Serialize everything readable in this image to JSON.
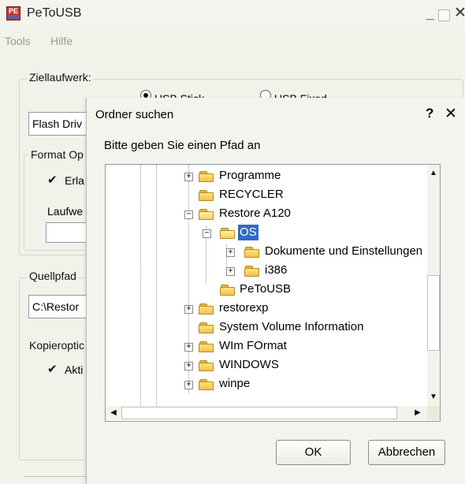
{
  "app": {
    "title": "PeToUSB",
    "icon_text": "PE",
    "menu": [
      "Tools",
      "Hilfe"
    ]
  },
  "main": {
    "ziellaufwerk_label": "Ziellaufwerk:",
    "radio_usb_stick": "USB Stick",
    "radio_usb_fixed": "USB Fixed",
    "drive_value": "Flash Driv",
    "format_label": "Format Op",
    "format_checkbox_label": "Erla",
    "laufwerk_label": "Laufwe",
    "quellpfad_label": "Quellpfad",
    "quellpfad_value": "C:\\Restor",
    "kopier_label": "Kopieroptic",
    "kopier_checkbox_label": "Akti"
  },
  "dialog": {
    "title": "Ordner suchen",
    "help": "?",
    "close": "✕",
    "prompt": "Bitte geben Sie einen Pfad an",
    "tree": [
      {
        "label": "Programme",
        "expander": "+",
        "level": 0
      },
      {
        "label": "RECYCLER",
        "expander": "",
        "level": 0
      },
      {
        "label": "Restore A120",
        "expander": "−",
        "level": 0
      },
      {
        "label": "OS",
        "expander": "−",
        "level": 1,
        "selected": true
      },
      {
        "label": "Dokumente und Einstellungen",
        "expander": "+",
        "level": 2
      },
      {
        "label": "i386",
        "expander": "+",
        "level": 2
      },
      {
        "label": "PeToUSB",
        "expander": "",
        "level": 1
      },
      {
        "label": "restorexp",
        "expander": "+",
        "level": 0
      },
      {
        "label": "System Volume Information",
        "expander": "",
        "level": 0
      },
      {
        "label": "WIm FOrmat",
        "expander": "+",
        "level": 0
      },
      {
        "label": "WINDOWS",
        "expander": "+",
        "level": 0
      },
      {
        "label": "winpe",
        "expander": "+",
        "level": 0
      }
    ],
    "ok_label": "OK",
    "cancel_label": "Abbrechen"
  }
}
